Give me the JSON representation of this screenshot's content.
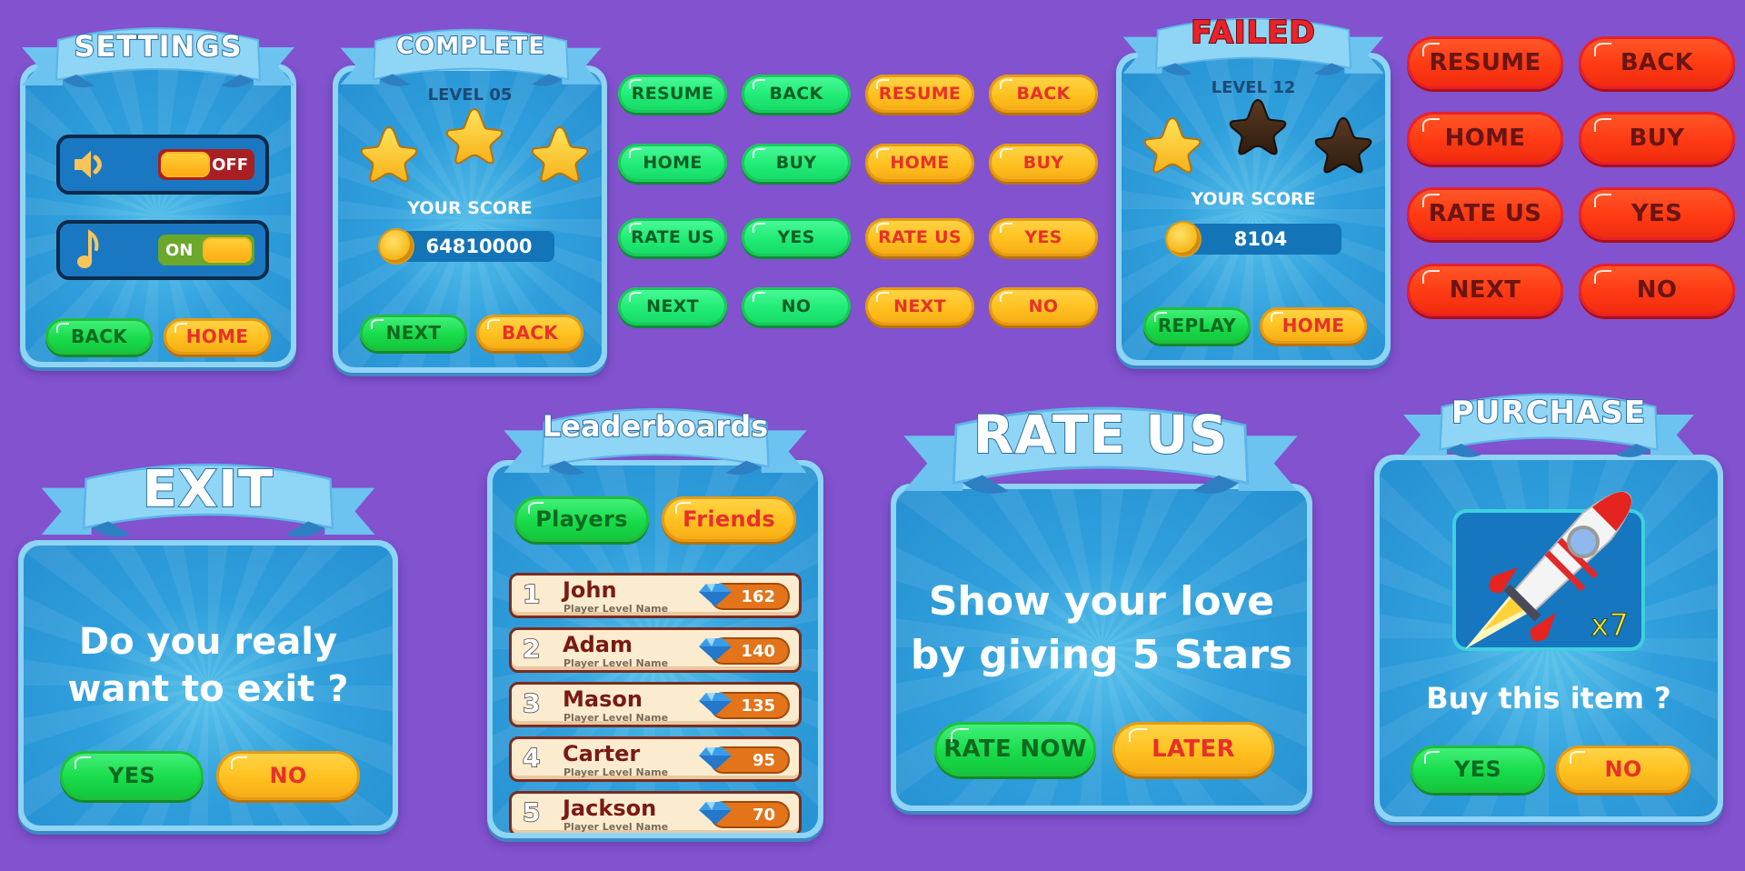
{
  "colors": {
    "background": "#8252cf",
    "panel": "#2f9fdc",
    "green_button": "#18dc4a",
    "yellow_button": "#ffc11f",
    "red_button": "#ff3a12"
  },
  "settings": {
    "title": "SETTINGS",
    "sound": {
      "icon": "speaker-icon",
      "state": "OFF"
    },
    "music": {
      "icon": "music-note-icon",
      "state": "ON"
    },
    "buttons": [
      "BACK",
      "HOME"
    ]
  },
  "complete": {
    "title": "COMPLETE",
    "level": "LEVEL 05",
    "stars_earned": 3,
    "stars_total": 3,
    "score_label": "YOUR SCORE",
    "score": "64810000",
    "buttons": [
      "NEXT",
      "BACK"
    ]
  },
  "button_sets": {
    "green": [
      "RESUME",
      "BACK",
      "HOME",
      "BUY",
      "RATE US",
      "YES",
      "NEXT",
      "NO"
    ],
    "yellow": [
      "RESUME",
      "BACK",
      "HOME",
      "BUY",
      "RATE US",
      "YES",
      "NEXT",
      "NO"
    ],
    "red": [
      "RESUME",
      "BACK",
      "HOME",
      "BUY",
      "RATE US",
      "YES",
      "NEXT",
      "NO"
    ]
  },
  "failed": {
    "title": "FAILED",
    "level": "LEVEL 12",
    "stars_earned": 1,
    "stars_total": 3,
    "score_label": "YOUR SCORE",
    "score": "8104",
    "buttons": [
      "REPLAY",
      "HOME"
    ]
  },
  "exit": {
    "title": "EXIT",
    "message_line1": "Do you realy",
    "message_line2": "want to exit ?",
    "buttons": [
      "YES",
      "NO"
    ]
  },
  "leaderboards": {
    "title": "Leaderboards",
    "tabs": [
      "Players",
      "Friends"
    ],
    "rows": [
      {
        "rank": "1",
        "name": "John",
        "subtitle": "Player Level Name",
        "score": "162"
      },
      {
        "rank": "2",
        "name": "Adam",
        "subtitle": "Player Level Name",
        "score": "140"
      },
      {
        "rank": "3",
        "name": "Mason",
        "subtitle": "Player Level Name",
        "score": "135"
      },
      {
        "rank": "4",
        "name": "Carter",
        "subtitle": "Player Level Name",
        "score": "95"
      },
      {
        "rank": "5",
        "name": "Jackson",
        "subtitle": "Player Level Name",
        "score": "70"
      }
    ]
  },
  "rate_us": {
    "title": "RATE US",
    "message_line1": "Show your love",
    "message_line2": "by giving 5 Stars",
    "buttons": [
      "RATE NOW",
      "LATER"
    ]
  },
  "purchase": {
    "title": "PURCHASE",
    "item_icon": "rocket-icon",
    "quantity": "x7",
    "question": "Buy this item ?",
    "buttons": [
      "YES",
      "NO"
    ]
  }
}
